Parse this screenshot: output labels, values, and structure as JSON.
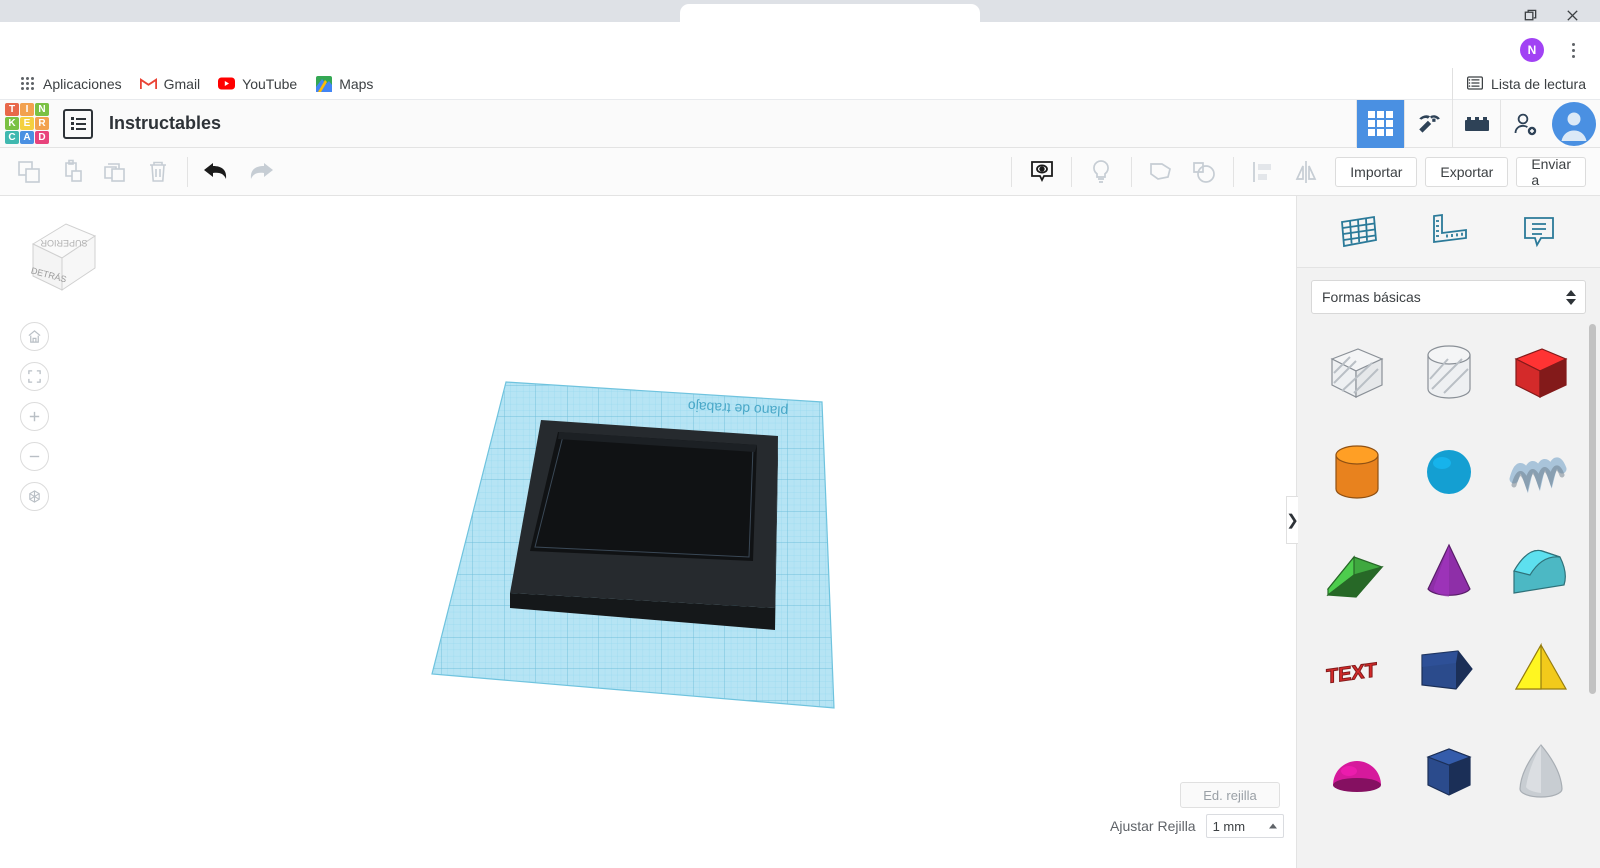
{
  "browser": {
    "restore_icon": "restore-window-icon",
    "close_icon": "close-icon",
    "profile_initial": "N",
    "menu_icon": "kebab-menu-icon",
    "bookmarks": [
      {
        "label": "Aplicaciones",
        "icon": "apps-grid-icon"
      },
      {
        "label": "Gmail",
        "icon": "gmail-icon"
      },
      {
        "label": "YouTube",
        "icon": "youtube-icon"
      },
      {
        "label": "Maps",
        "icon": "maps-icon"
      }
    ],
    "reading_list": {
      "label": "Lista de lectura",
      "icon": "reading-list-icon"
    }
  },
  "app_header": {
    "logo_letters": [
      "T",
      "I",
      "N",
      "K",
      "E",
      "R",
      "C",
      "A",
      "D"
    ],
    "logo_colors": [
      "#e8684a",
      "#f2a14e",
      "#7ac143",
      "#7ac143",
      "#f4d03f",
      "#f2a14e",
      "#3fb8af",
      "#4a90e2",
      "#e8437c"
    ],
    "project_icon": "project-list-icon",
    "project_title": "Instructables",
    "right_icons": [
      {
        "name": "designs-grid-icon",
        "active": true
      },
      {
        "name": "minecraft-pickaxe-icon",
        "active": false
      },
      {
        "name": "lego-brick-icon",
        "active": false
      },
      {
        "name": "add-person-icon",
        "active": false
      }
    ],
    "avatar": "user-avatar"
  },
  "toolbar": {
    "left_icons": [
      {
        "name": "copy-icon",
        "active": false
      },
      {
        "name": "paste-icon",
        "active": false
      },
      {
        "name": "duplicate-icon",
        "active": false
      },
      {
        "name": "delete-trash-icon",
        "active": false
      }
    ],
    "history_icons": [
      {
        "name": "undo-icon",
        "active": true
      },
      {
        "name": "redo-icon",
        "active": false
      }
    ],
    "right_icons": [
      {
        "name": "visibility-eye-icon",
        "active": true
      },
      {
        "name": "lightbulb-icon",
        "active": false
      },
      {
        "name": "group-shape-icon",
        "active": false
      },
      {
        "name": "ungroup-shape-icon",
        "active": false
      },
      {
        "name": "align-icon",
        "active": false
      },
      {
        "name": "mirror-icon",
        "active": false
      }
    ],
    "buttons": [
      {
        "label": "Importar"
      },
      {
        "label": "Exportar"
      },
      {
        "label": "Enviar a"
      }
    ]
  },
  "viewport": {
    "viewcube": {
      "top_face": "SUPERIOR",
      "front_face": "DETRÁS"
    },
    "nav_buttons": [
      {
        "name": "home-view-icon"
      },
      {
        "name": "fit-to-view-icon"
      },
      {
        "name": "zoom-in-icon"
      },
      {
        "name": "zoom-out-icon"
      },
      {
        "name": "orthographic-view-icon"
      }
    ],
    "workplane_label": "plano de trabajo",
    "workplane_color": "#b3e5f5",
    "object_color": "#17191b",
    "grid_edit_button": "Ed. rejilla",
    "snap_label": "Ajustar Rejilla",
    "snap_value": "1 mm"
  },
  "panel": {
    "tabs": [
      {
        "name": "workplane-grid-icon"
      },
      {
        "name": "ruler-icon"
      },
      {
        "name": "notes-icon"
      }
    ],
    "category": "Formas básicas",
    "collapse_chevron": "❯",
    "shapes": [
      {
        "name": "hole-box",
        "color": "#d4d8dc",
        "kind": "hole-box"
      },
      {
        "name": "hole-cylinder",
        "color": "#d4d8dc",
        "kind": "hole-cylinder"
      },
      {
        "name": "box",
        "color": "#d42a2a",
        "kind": "box"
      },
      {
        "name": "cylinder",
        "color": "#e8821e",
        "kind": "cylinder"
      },
      {
        "name": "sphere",
        "color": "#149fd2",
        "kind": "sphere"
      },
      {
        "name": "scribble",
        "color": "#a9c4da",
        "kind": "scribble"
      },
      {
        "name": "wedge",
        "color": "#3fa83f",
        "kind": "wedge"
      },
      {
        "name": "cone",
        "color": "#8e2fa8",
        "kind": "cone"
      },
      {
        "name": "roof",
        "color": "#4cb8c4",
        "kind": "roof"
      },
      {
        "name": "text",
        "color": "#d42a2a",
        "kind": "text",
        "label": "TEXT"
      },
      {
        "name": "arrow-block",
        "color": "#2b4b8c",
        "kind": "arrow"
      },
      {
        "name": "pyramid",
        "color": "#f2ca1b",
        "kind": "pyramid"
      },
      {
        "name": "half-sphere",
        "color": "#d6199c",
        "kind": "halfsphere"
      },
      {
        "name": "hexagonal-prism",
        "color": "#2b4b8c",
        "kind": "hexprism"
      },
      {
        "name": "paraboloid",
        "color": "#c8cdd2",
        "kind": "paraboloid"
      }
    ]
  }
}
